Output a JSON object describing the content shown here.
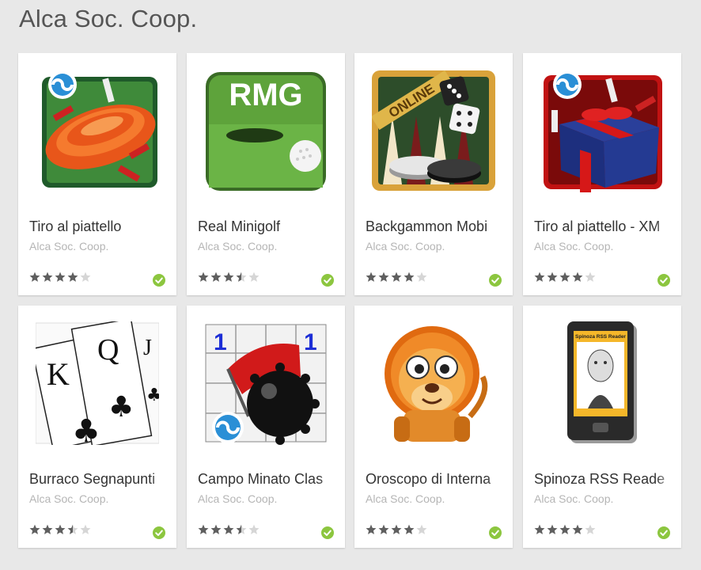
{
  "page": {
    "developer_title": "Alca Soc. Coop."
  },
  "colors": {
    "background": "#e8e8e8",
    "star_filled": "#5f5f5f",
    "star_empty": "#d6d6d6",
    "badge_green": "#8cc63f"
  },
  "apps": [
    {
      "title": "Tiro al piattello",
      "developer": "Alca Soc. Coop.",
      "rating": 4.0,
      "icon": "clay-pigeon-icon"
    },
    {
      "title": "Real Minigolf",
      "developer": "Alca Soc. Coop.",
      "rating": 3.5,
      "icon": "minigolf-icon",
      "icon_text": "RMG"
    },
    {
      "title": "Backgammon Mobi",
      "developer": "Alca Soc. Coop.",
      "rating": 4.0,
      "icon": "backgammon-icon",
      "icon_text": "ONLINE"
    },
    {
      "title": "Tiro al piattello - XM",
      "developer": "Alca Soc. Coop.",
      "rating": 4.0,
      "icon": "gift-icon"
    },
    {
      "title": "Burraco Segnapunti",
      "developer": "Alca Soc. Coop.",
      "rating": 3.5,
      "icon": "playing-cards-icon"
    },
    {
      "title": "Campo Minato Clas",
      "developer": "Alca Soc. Coop.",
      "rating": 3.5,
      "icon": "minesweeper-icon"
    },
    {
      "title": "Oroscopo di Interna",
      "developer": "Alca Soc. Coop.",
      "rating": 4.0,
      "icon": "lion-icon"
    },
    {
      "title": "Spinoza RSS Reade",
      "developer": "Alca Soc. Coop.",
      "rating": 4.0,
      "icon": "rss-reader-phone-icon",
      "icon_text": "Spinoza RSS Reader"
    }
  ]
}
